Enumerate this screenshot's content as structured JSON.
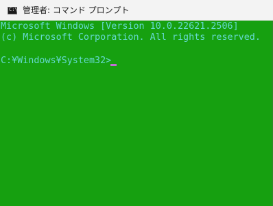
{
  "window": {
    "title": "管理者: コマンド プロンプト",
    "app_icon_glyph": "C:\\"
  },
  "console": {
    "lines": [
      "Microsoft Windows [Version 10.0.22621.2506]",
      "(c) Microsoft Corporation. All rights reserved.",
      "",
      "C:¥Windows¥System32>"
    ]
  },
  "colors": {
    "background": "#16a010",
    "text": "#65d9d0",
    "cursor": "#c26ed6",
    "titlebar": "#f3f3f3"
  }
}
